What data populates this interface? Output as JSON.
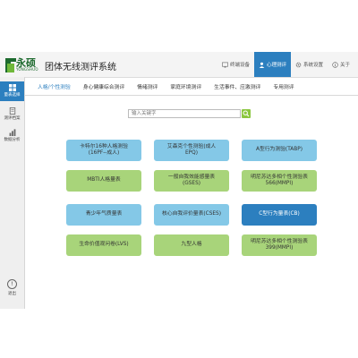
{
  "brand": {
    "name": "永硕",
    "sub": "YONGSHUO",
    "title": "团体无线测评系统"
  },
  "colors": {
    "accent": "#2c7fbf",
    "card_blue": "#84c8e7",
    "card_green": "#a8d47a",
    "logo_green": "#1d6a2e"
  },
  "top_nav": [
    {
      "label": "终端设备",
      "icon": "monitor-icon"
    },
    {
      "label": "心理测评",
      "icon": "user-icon",
      "active": true
    },
    {
      "label": "系统设置",
      "icon": "gear-icon"
    },
    {
      "label": "关于",
      "icon": "info-icon"
    }
  ],
  "sidebar": {
    "items": [
      {
        "label": "量表选择",
        "icon": "grid-icon",
        "active": true
      },
      {
        "label": "测评档案",
        "icon": "file-icon"
      },
      {
        "label": "数据分析",
        "icon": "chart-icon"
      }
    ],
    "exit_label": "退出"
  },
  "tabs": [
    {
      "label": "人格/个性测验",
      "active": true
    },
    {
      "label": "身心健康综合测评"
    },
    {
      "label": "情绪测评"
    },
    {
      "label": "家庭环境测评"
    },
    {
      "label": "生活事件、应激测评"
    },
    {
      "label": "专用测评"
    }
  ],
  "search": {
    "placeholder": "输入关键字"
  },
  "tests": [
    {
      "label": "卡特尔16种人格测验\n(16PF--成人)",
      "color": "blue"
    },
    {
      "label": "艾森克个性测验(成人\nEPQ)",
      "color": "blue"
    },
    {
      "label": "A型行为测验(TABP)",
      "color": "blue"
    },
    {
      "label": "MBTI人格量表",
      "color": "green"
    },
    {
      "label": "一般自我效能感量表\n(GSES)",
      "color": "green"
    },
    {
      "label": "明尼苏达多相个性测验表\n566(MMPI)",
      "color": "green"
    },
    {
      "label": "青少年气质量表",
      "color": "blue"
    },
    {
      "label": "核心自我评价量表(CSES)",
      "color": "blue"
    },
    {
      "label": "C型行为量表(CB)",
      "color": "dark"
    },
    {
      "label": "生命价值观问卷(LVS)",
      "color": "green"
    },
    {
      "label": "九型人格",
      "color": "green"
    },
    {
      "label": "明尼苏达多相个性测验表\n399(MMPI)",
      "color": "green"
    }
  ]
}
